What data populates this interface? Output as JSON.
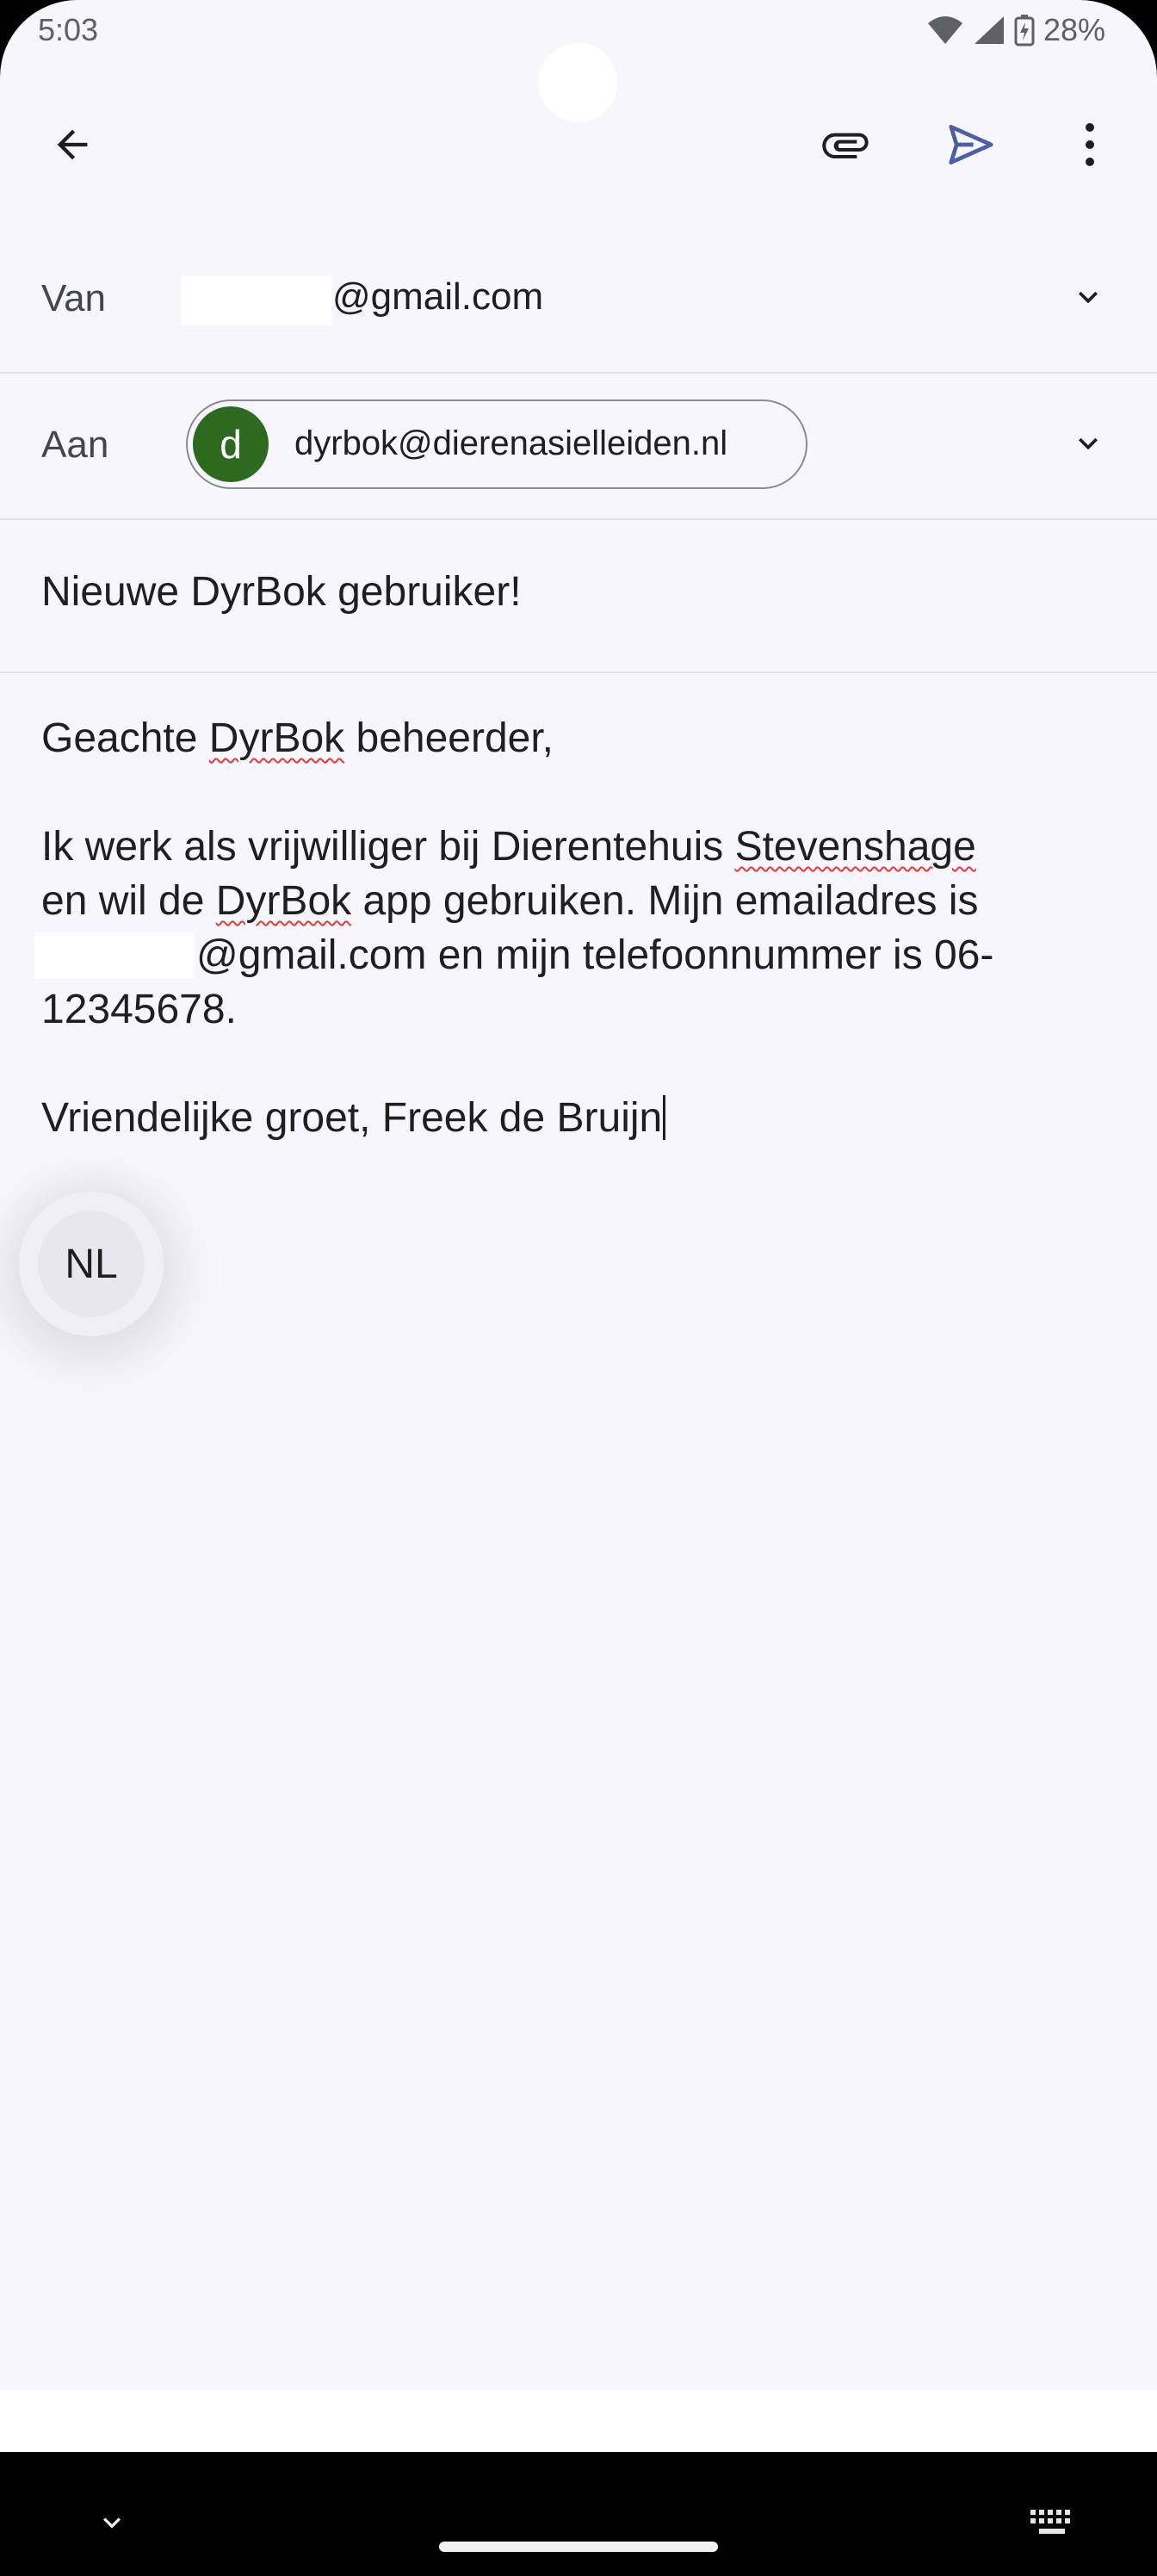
{
  "status_bar": {
    "time": "5:03",
    "battery": "28%",
    "icons": [
      "wifi-icon",
      "signal-icon",
      "battery-charging-icon"
    ]
  },
  "toolbar": {
    "back_icon": "arrow-left-icon",
    "attach_icon": "paperclip-icon",
    "send_icon": "send-icon",
    "more_icon": "more-vert-icon",
    "send_color": "#4a5fa5"
  },
  "from": {
    "label": "Van",
    "value": "@gmail.com"
  },
  "to": {
    "label": "Aan",
    "chip_initial": "d",
    "chip_email": "dyrbok@dierenasielleiden.nl",
    "chip_avatar_color": "#2d6a1f"
  },
  "subject": {
    "value": "Nieuwe DyrBok gebruiker!"
  },
  "body": {
    "greeting_pre": "Geachte ",
    "greeting_word": "DyrBok",
    "greeting_post": " beheerder,",
    "line2_pre": "Ik werk als vrijwilliger bij Dierentehuis ",
    "line2_word": "Stevenshage",
    "line3_pre": "en wil de ",
    "line3_word": "DyrBok",
    "line3_post": " app gebruiken. Mijn emailadres is",
    "line4": "@gmail.com en mijn telefoonnummer is 06-",
    "line5": "12345678.",
    "closing": "Vriendelijke groet, Freek de Bruijn"
  },
  "language_bubble": {
    "label": "NL"
  },
  "navigation": {
    "icons": [
      "chevron-down-icon",
      "keyboard-icon"
    ]
  }
}
